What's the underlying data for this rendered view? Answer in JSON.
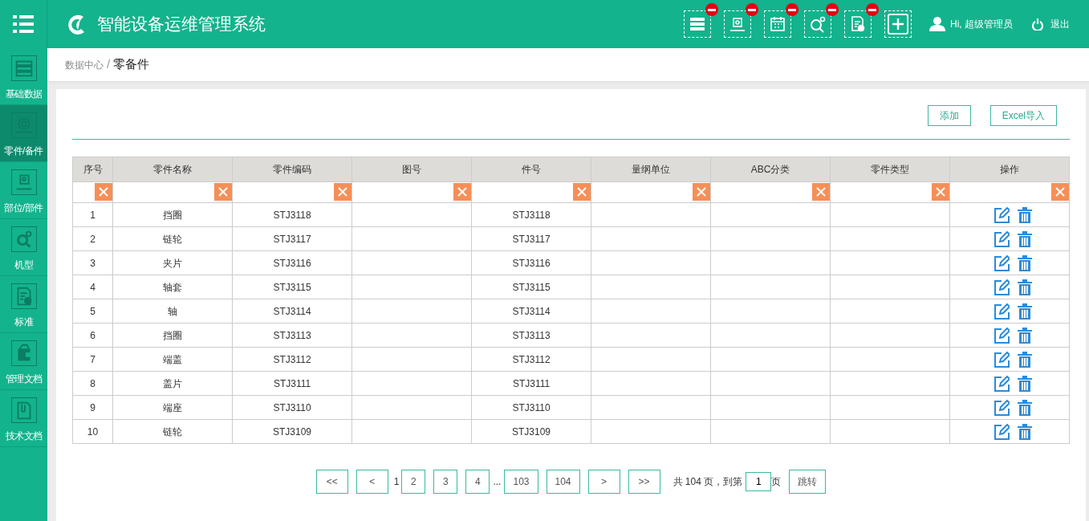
{
  "header": {
    "title": "智能设备运维管理系统",
    "user_greeting": "Hi, 超级管理员",
    "logout": "退出"
  },
  "shortcuts": [
    {
      "kind": "shortcut",
      "removable": true
    },
    {
      "kind": "shortcut",
      "removable": true
    },
    {
      "kind": "shortcut",
      "removable": true
    },
    {
      "kind": "shortcut",
      "removable": true
    },
    {
      "kind": "shortcut",
      "removable": true
    },
    {
      "kind": "add",
      "removable": false
    }
  ],
  "sidebar": {
    "items": [
      {
        "label": "基础数据",
        "selected": false
      },
      {
        "label": "零件/备件",
        "selected": true
      },
      {
        "label": "部位/部件",
        "selected": false
      },
      {
        "label": "机型",
        "selected": false
      },
      {
        "label": "标准",
        "selected": false
      },
      {
        "label": "管理文档",
        "selected": false
      },
      {
        "label": "技术文档",
        "selected": false
      }
    ]
  },
  "breadcrumb": {
    "separator": "/",
    "items": [
      {
        "label": "数据中心"
      },
      {
        "label": "零备件"
      }
    ]
  },
  "actions": [
    "添加",
    "Excel导入"
  ],
  "table": {
    "columns": [
      {
        "label": "序号",
        "kind": "text"
      },
      {
        "label": "零件名称",
        "kind": "text"
      },
      {
        "label": "零件编码",
        "kind": "text"
      },
      {
        "label": "图号",
        "kind": "text"
      },
      {
        "label": "件号",
        "kind": "text"
      },
      {
        "label": "量纲单位",
        "kind": "text"
      },
      {
        "label": "ABC分类",
        "kind": "text"
      },
      {
        "label": "零件类型",
        "kind": "text"
      },
      {
        "label": "操作",
        "kind": "actions"
      }
    ],
    "rows": [
      {
        "cells": [
          "1",
          "挡圈",
          "STJ3118",
          null,
          "STJ3118",
          null,
          null,
          null
        ]
      },
      {
        "cells": [
          "2",
          "链轮",
          "STJ3117",
          null,
          "STJ3117",
          null,
          null,
          null
        ]
      },
      {
        "cells": [
          "3",
          "夹片",
          "STJ3116",
          null,
          "STJ3116",
          null,
          null,
          null
        ]
      },
      {
        "cells": [
          "4",
          "轴套",
          "STJ3115",
          null,
          "STJ3115",
          null,
          null,
          null
        ]
      },
      {
        "cells": [
          "5",
          "轴",
          "STJ3114",
          null,
          "STJ3114",
          null,
          null,
          null
        ]
      },
      {
        "cells": [
          "6",
          "挡圈",
          "STJ3113",
          null,
          "STJ3113",
          null,
          null,
          null
        ]
      },
      {
        "cells": [
          "7",
          "端盖",
          "STJ3112",
          null,
          "STJ3112",
          null,
          null,
          null
        ]
      },
      {
        "cells": [
          "8",
          "盖片",
          "STJ3111",
          null,
          "STJ3111",
          null,
          null,
          null
        ]
      },
      {
        "cells": [
          "9",
          "端座",
          "STJ3110",
          null,
          "STJ3110",
          null,
          null,
          null
        ]
      },
      {
        "cells": [
          "10",
          "链轮",
          "STJ3109",
          null,
          "STJ3109",
          null,
          null,
          null
        ]
      }
    ]
  },
  "pagination": {
    "pages": [
      {
        "label": "<<",
        "kind": "nav"
      },
      {
        "label": "<",
        "kind": "nav"
      },
      {
        "label": "1",
        "kind": "page",
        "selected": true
      },
      {
        "label": "2",
        "kind": "page",
        "selected": false
      },
      {
        "label": "3",
        "kind": "page",
        "selected": false
      },
      {
        "label": "4",
        "kind": "page",
        "selected": false
      },
      {
        "label": "...",
        "kind": "ellipsis"
      },
      {
        "label": "103",
        "kind": "page",
        "selected": false
      },
      {
        "label": "104",
        "kind": "page",
        "selected": false
      },
      {
        "label": ">",
        "kind": "nav"
      },
      {
        "label": ">>",
        "kind": "nav"
      }
    ],
    "total": "共 104 页，到第",
    "jump_value": "1",
    "suffix": "页",
    "jump_button": "跳转"
  }
}
